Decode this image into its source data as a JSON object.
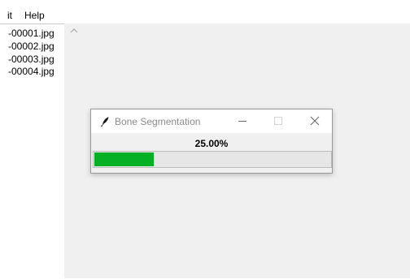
{
  "menu": {
    "items": [
      "it",
      "Help"
    ]
  },
  "file_list": {
    "items": [
      "-00001.jpg",
      "-00002.jpg",
      "-00003.jpg",
      "-00004.jpg"
    ]
  },
  "dialog": {
    "title": "Bone Segmentation",
    "percent_label": "25.00%",
    "progress": 0.25,
    "progress_color": "#06b025",
    "icon": "feather-icon"
  }
}
